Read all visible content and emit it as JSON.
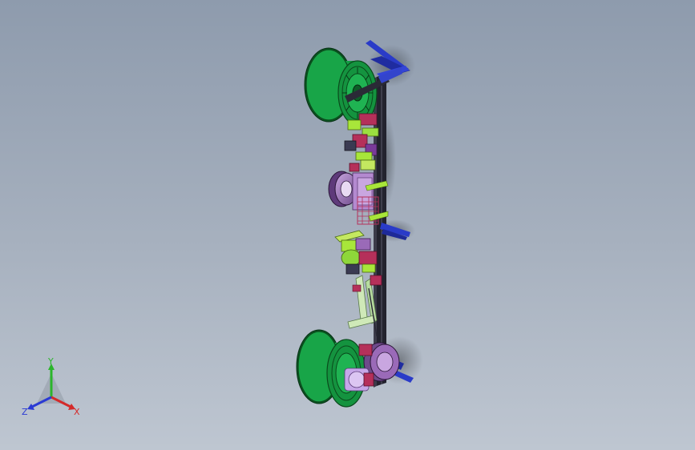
{
  "viewport": {
    "name": "3D model view"
  },
  "triad": {
    "x_label": "X",
    "y_label": "Y",
    "z_label": "Z",
    "colors": {
      "x": "#d42a2a",
      "y": "#2bb52b",
      "z": "#2a3ad4"
    }
  },
  "colors": {
    "spool": "#16a34a",
    "spool_dark": "#0a5c22",
    "frame": "#1e1e28",
    "blue_bracket": "#2a3bc8",
    "purple_motor": "#9a6ab8",
    "lavender": "#c6a7e8",
    "yellow_green": "#a8e63a",
    "magenta": "#b5305a",
    "pale_green": "#cfe9b8",
    "background_top": "#8e9bad",
    "background_bottom": "#bec6d1"
  }
}
